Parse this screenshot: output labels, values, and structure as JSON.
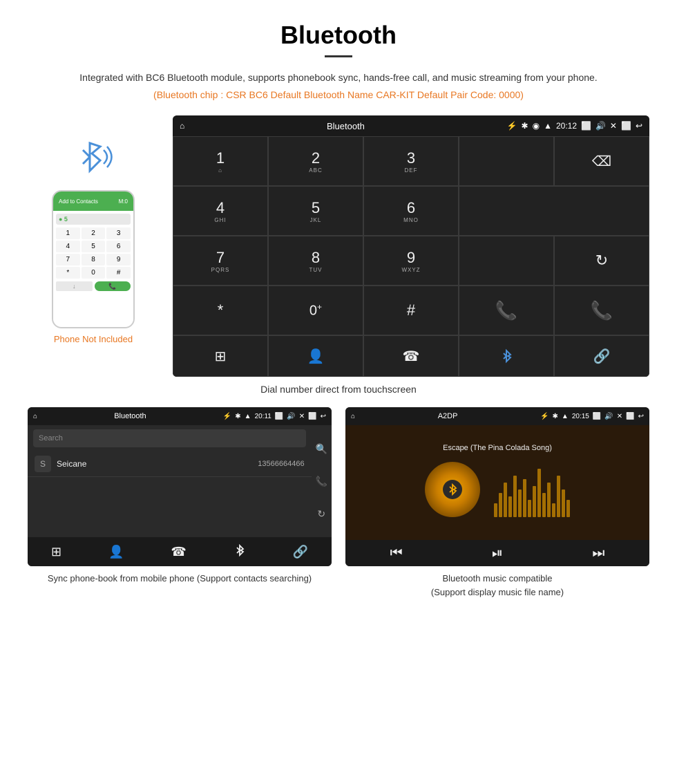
{
  "page": {
    "title": "Bluetooth",
    "subtitle": "Integrated with BC6 Bluetooth module, supports phonebook sync, hands-free call, and music streaming from your phone.",
    "orange_info": "(Bluetooth chip : CSR BC6    Default Bluetooth Name CAR-KIT    Default Pair Code: 0000)"
  },
  "phone_illustration": {
    "not_included_label": "Phone Not Included",
    "top_bar_text": "Add to Contacts",
    "dial_keys": [
      "1",
      "2",
      "3",
      "4",
      "5",
      "6",
      "7",
      "8",
      "9",
      "*",
      "0",
      "#"
    ]
  },
  "dial_screen": {
    "status_bar": {
      "home_icon": "⌂",
      "title": "Bluetooth",
      "usb_icon": "⚡",
      "bluetooth_icon": "⚡",
      "location_icon": "◉",
      "signal_icon": "▲",
      "time": "20:12",
      "camera_icon": "📷",
      "volume_icon": "🔊",
      "x_icon": "✕",
      "back_icon": "↩"
    },
    "keys": [
      {
        "label": "1",
        "sub": "⌂"
      },
      {
        "label": "2",
        "sub": "ABC"
      },
      {
        "label": "3",
        "sub": "DEF"
      },
      {
        "label": "⌫",
        "sub": ""
      },
      {
        "label": "4",
        "sub": "GHI"
      },
      {
        "label": "5",
        "sub": "JKL"
      },
      {
        "label": "6",
        "sub": "MNO"
      },
      {
        "label": "",
        "sub": ""
      },
      {
        "label": "7",
        "sub": "PQRS"
      },
      {
        "label": "8",
        "sub": "TUV"
      },
      {
        "label": "9",
        "sub": "WXYZ"
      },
      {
        "label": "↻",
        "sub": ""
      },
      {
        "label": "*",
        "sub": ""
      },
      {
        "label": "0+",
        "sub": ""
      },
      {
        "label": "#",
        "sub": ""
      },
      {
        "label": "☎",
        "sub": "green"
      },
      {
        "label": "☎",
        "sub": "red"
      }
    ],
    "bottom_keys": [
      "⊞",
      "👤",
      "☎",
      "✱",
      "🔗"
    ]
  },
  "dial_caption": "Dial number direct from touchscreen",
  "phonebook_screen": {
    "status_bar_title": "Bluetooth",
    "time": "20:11",
    "search_placeholder": "Search",
    "contacts": [
      {
        "initial": "S",
        "name": "Seicane",
        "number": "13566664466"
      }
    ],
    "bottom_icons": [
      "⊞",
      "👤",
      "☎",
      "✱",
      "🔗"
    ]
  },
  "music_screen": {
    "status_bar_title": "A2DP",
    "time": "20:15",
    "song_title": "Escape (The Pina Colada Song)",
    "controls": [
      "⏮",
      "⏯",
      "⏭"
    ]
  },
  "captions": {
    "phonebook": "Sync phone-book from mobile phone\n(Support contacts searching)",
    "music": "Bluetooth music compatible\n(Support display music file name)"
  }
}
